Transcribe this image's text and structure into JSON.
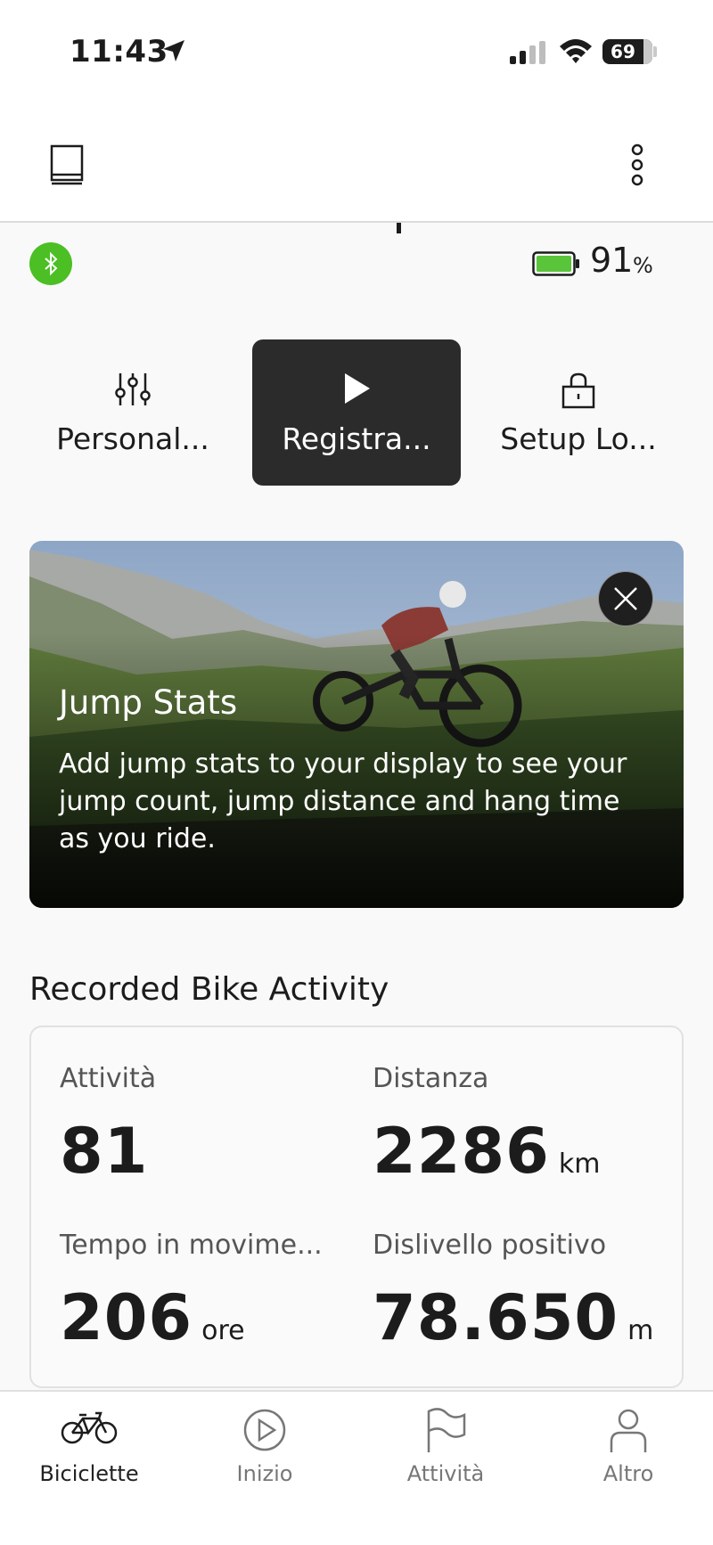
{
  "status_bar": {
    "time": "11:43",
    "battery": "69"
  },
  "header": {
    "left_icon": "panel-icon",
    "right_icon": "more-vertical-icon"
  },
  "bike": {
    "bluetooth_color": "#4bbf24",
    "battery_value": "91",
    "battery_unit": "%"
  },
  "actions": [
    {
      "label": "Personal...",
      "icon": "sliders-icon"
    },
    {
      "label": "Registra...",
      "icon": "play-icon"
    },
    {
      "label": "Setup Lo...",
      "icon": "lock-icon"
    }
  ],
  "promo": {
    "title": "Jump Stats",
    "body": "Add jump stats to your display to see your jump count, jump distance and hang time as you ride."
  },
  "recorded": {
    "title": "Recorded Bike Activity",
    "stats": [
      {
        "label": "Attività",
        "value": "81",
        "unit": ""
      },
      {
        "label": "Distanza",
        "value": "2286",
        "unit": "km"
      },
      {
        "label": "Tempo in movime...",
        "value": "206",
        "unit": "ore"
      },
      {
        "label": "Dislivello positivo",
        "value": "78.650",
        "unit": "m"
      }
    ]
  },
  "tabs": [
    {
      "label": "Biciclette",
      "icon": "bike-icon",
      "active": true
    },
    {
      "label": "Inizio",
      "icon": "play-circle-icon",
      "active": false
    },
    {
      "label": "Attività",
      "icon": "flag-icon",
      "active": false
    },
    {
      "label": "Altro",
      "icon": "person-icon",
      "active": false
    }
  ]
}
